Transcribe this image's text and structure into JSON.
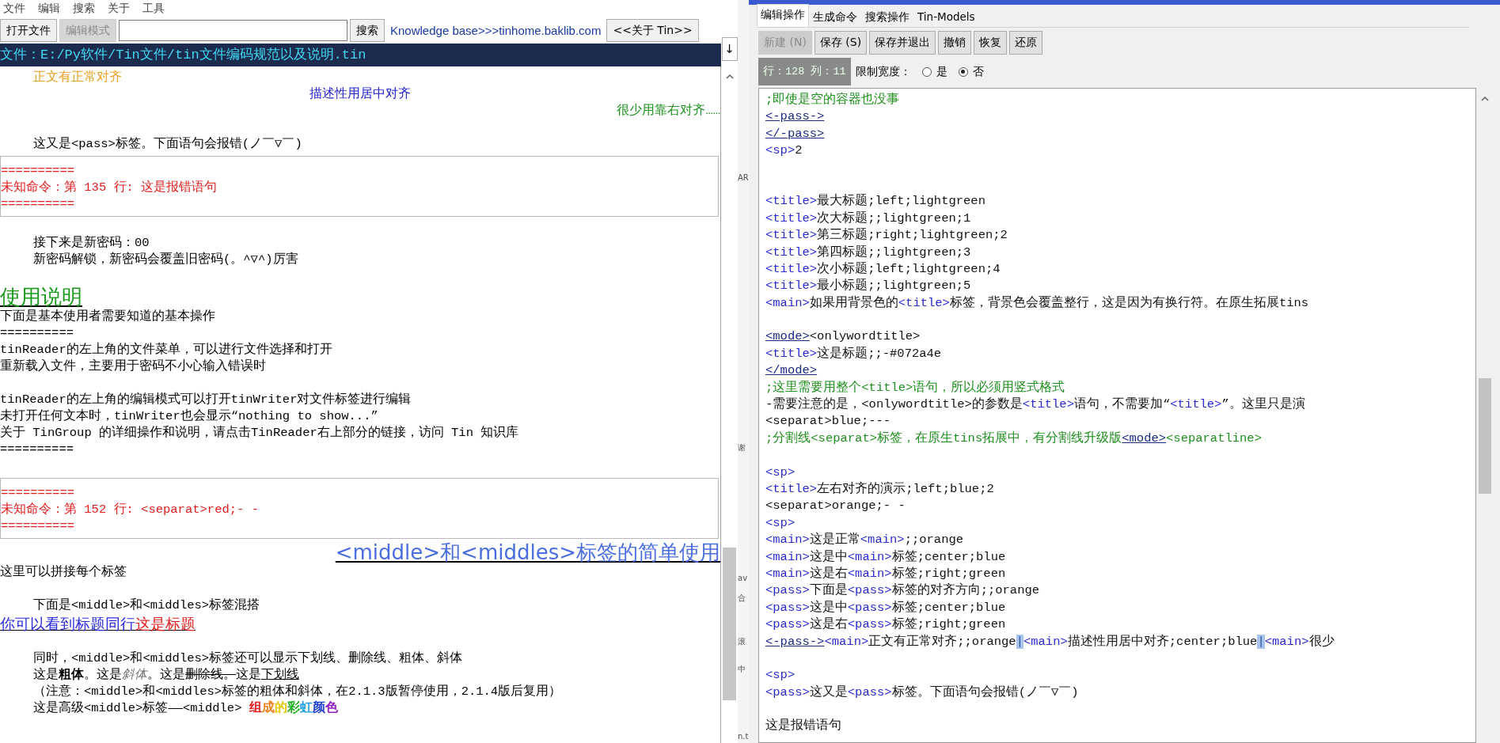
{
  "reader": {
    "menu": [
      "文件",
      "编辑",
      "搜索",
      "关于",
      "工具"
    ],
    "toolbar": {
      "open_button": {
        "label": "打开文件",
        "disabled": false
      },
      "edit_mode_button": {
        "label": "编辑模式",
        "disabled": true
      },
      "search_button": "搜索",
      "knowledge_link": "Knowledge base>>>tinhome.baklib.com",
      "about_button": "<<关于 Tin>>"
    },
    "scroll_down_button": "↓",
    "file_path": "文件：E:/Py软件/Tin文件/tin文件编码规范以及说明.tin",
    "lines": [
      {
        "kind": "indented",
        "segments": [
          {
            "text": "正文有正常对齐",
            "color": "#e8a020"
          }
        ]
      },
      {
        "kind": "center",
        "segments": [
          {
            "text": "描述性用居中对齐",
            "color": "#2020d0"
          }
        ]
      },
      {
        "kind": "right",
        "segments": [
          {
            "text": "很少用靠右对齐……",
            "color": "#209020"
          }
        ]
      },
      {
        "kind": "blank"
      },
      {
        "kind": "indented",
        "segments": [
          {
            "text": "这又是<pass>标签。下面语句会报错(ノ￣▽￣)"
          }
        ]
      },
      {
        "kind": "error_box",
        "lines": [
          "==========",
          "未知命令：第 135 行: 这是报错语句",
          "=========="
        ]
      },
      {
        "kind": "blank"
      },
      {
        "kind": "indented",
        "segments": [
          {
            "text": "接下来是新密码：00"
          }
        ]
      },
      {
        "kind": "indented",
        "segments": [
          {
            "text": "新密码解锁，新密码会覆盖旧密码(。^▽^)厉害"
          }
        ]
      },
      {
        "kind": "blank"
      },
      {
        "kind": "heading",
        "segments": [
          {
            "text": "使用说明",
            "color": "#1a9a1a"
          }
        ]
      },
      {
        "kind": "text",
        "segments": [
          {
            "text": "下面是基本使用者需要知道的基本操作"
          }
        ]
      },
      {
        "kind": "text",
        "segments": [
          {
            "text": "=========="
          }
        ]
      },
      {
        "kind": "text",
        "segments": [
          {
            "text": "tinReader的左上角的文件菜单，可以进行文件选择和打开"
          }
        ]
      },
      {
        "kind": "text",
        "segments": [
          {
            "text": "重新载入文件，主要用于密码不小心输入错误时"
          }
        ]
      },
      {
        "kind": "blank"
      },
      {
        "kind": "text",
        "segments": [
          {
            "text": "tinReader的左上角的编辑模式可以打开tinWriter对文件标签进行编辑"
          }
        ]
      },
      {
        "kind": "text",
        "segments": [
          {
            "text": "未打开任何文本时，tinWriter也会显示“nothing to show...”"
          }
        ]
      },
      {
        "kind": "text",
        "segments": [
          {
            "text": "关于 TinGroup 的详细操作和说明，请点击TinReader右上部分的链接，访问 Tin 知识库"
          }
        ]
      },
      {
        "kind": "text",
        "segments": [
          {
            "text": "=========="
          }
        ]
      },
      {
        "kind": "blank"
      },
      {
        "kind": "error_box",
        "lines": [
          "==========",
          "未知命令：第 152 行: <separat>red;- -",
          "=========="
        ]
      },
      {
        "kind": "heading_right",
        "segments": [
          {
            "text": "<middle>和<middles>标签的简单使用",
            "color": "#4a6ee0"
          }
        ]
      },
      {
        "kind": "text",
        "segments": [
          {
            "text": "这里可以拼接每个标签"
          }
        ]
      },
      {
        "kind": "blank"
      },
      {
        "kind": "indented",
        "segments": [
          {
            "text": "下面是<middle>和<middles>标签混搭"
          }
        ]
      },
      {
        "kind": "title",
        "segments": [
          {
            "text": "你可以看到标题同行",
            "color": "#2a2ae0"
          },
          {
            "text": "这是标题",
            "color": "#e02020"
          }
        ]
      },
      {
        "kind": "blank"
      },
      {
        "kind": "indented",
        "segments": [
          {
            "text": "同时，<middle>和<middles>标签还可以显示下划线、删除线、粗体、斜体"
          }
        ]
      },
      {
        "kind": "styles_demo",
        "segments": [
          {
            "text": "这是"
          },
          {
            "text": "粗体"
          },
          {
            "text": "。这是"
          },
          {
            "text": "斜体",
            "color": "#707070"
          },
          {
            "text": "。这是"
          },
          {
            "text": "删除线。"
          },
          {
            "text": "这是"
          },
          {
            "text": "下划线"
          }
        ]
      },
      {
        "kind": "indented",
        "segments": [
          {
            "text": "（注意：<middle>和<middles>标签的粗体和斜体，在2.1.3版暂停使用，2.1.4版后复用）"
          }
        ]
      },
      {
        "kind": "rainbow",
        "segments": [
          {
            "text": "这是高级<middle>标签——<middle> "
          },
          {
            "text": "组",
            "color": "#e02020"
          },
          {
            "text": "成",
            "color": "#f08020"
          },
          {
            "text": "的",
            "color": "#e8c800"
          },
          {
            "text": "彩",
            "color": "#20b020"
          },
          {
            "text": "虹",
            "color": "#20a0e0"
          },
          {
            "text": "颜",
            "color": "#2040d0"
          },
          {
            "text": "色",
            "color": "#9020c0"
          }
        ]
      }
    ]
  },
  "background_window": {
    "fragments": [
      "AR",
      "谢",
      "av",
      "合",
      "滚",
      "中",
      "n.t"
    ]
  },
  "writer": {
    "tabs": [
      {
        "label": "编辑操作",
        "selected": true
      },
      {
        "label": "生成命令",
        "selected": false
      },
      {
        "label": "搜索操作",
        "selected": false
      },
      {
        "label": "Tin-Models",
        "selected": false
      }
    ],
    "buttons": [
      {
        "label": "新建 (N)",
        "disabled": true
      },
      {
        "label": "保存 (S)",
        "disabled": false
      },
      {
        "label": "保存并退出",
        "disabled": false
      },
      {
        "label": "撤销",
        "disabled": false
      },
      {
        "label": "恢复",
        "disabled": false
      },
      {
        "label": "还原",
        "disabled": false
      }
    ],
    "cursor_position": "行：128 列：11",
    "width_limit": {
      "label": "限制宽度：",
      "options": [
        {
          "label": "是",
          "selected": false
        },
        {
          "label": "否",
          "selected": true
        }
      ]
    },
    "lines": [
      {
        "kind": "code",
        "segments": [
          {
            "kind": "comment",
            "text": ";即使是空的容器也没事"
          }
        ]
      },
      {
        "kind": "code",
        "segments": [
          {
            "kind": "link",
            "text": "<-pass->"
          }
        ]
      },
      {
        "kind": "code",
        "segments": [
          {
            "kind": "link",
            "text": "</-pass>"
          }
        ]
      },
      {
        "kind": "code",
        "segments": [
          {
            "kind": "tag",
            "text": "<sp>"
          },
          {
            "kind": "text",
            "text": "2"
          }
        ]
      },
      {
        "kind": "blank"
      },
      {
        "kind": "blank"
      },
      {
        "kind": "code",
        "segments": [
          {
            "kind": "tag",
            "text": "<title>"
          },
          {
            "kind": "text",
            "text": "最大标题;left;lightgreen"
          }
        ]
      },
      {
        "kind": "code",
        "segments": [
          {
            "kind": "tag",
            "text": "<title>"
          },
          {
            "kind": "text",
            "text": "次大标题;;lightgreen;1"
          }
        ]
      },
      {
        "kind": "code",
        "segments": [
          {
            "kind": "tag",
            "text": "<title>"
          },
          {
            "kind": "text",
            "text": "第三标题;right;lightgreen;2"
          }
        ]
      },
      {
        "kind": "code",
        "segments": [
          {
            "kind": "tag",
            "text": "<title>"
          },
          {
            "kind": "text",
            "text": "第四标题;;lightgreen;3"
          }
        ]
      },
      {
        "kind": "code",
        "segments": [
          {
            "kind": "tag",
            "text": "<title>"
          },
          {
            "kind": "text",
            "text": "次小标题;left;lightgreen;4"
          }
        ]
      },
      {
        "kind": "code",
        "segments": [
          {
            "kind": "tag",
            "text": "<title>"
          },
          {
            "kind": "text",
            "text": "最小标题;;lightgreen;5"
          }
        ]
      },
      {
        "kind": "code",
        "segments": [
          {
            "kind": "tag",
            "text": "<main>"
          },
          {
            "kind": "text",
            "text": "如果用背景色的"
          },
          {
            "kind": "tag",
            "text": "<title>"
          },
          {
            "kind": "text",
            "text": "标签，背景色会覆盖整行，这是因为有换行符。在原生拓展tins"
          }
        ]
      },
      {
        "kind": "blank"
      },
      {
        "kind": "code",
        "segments": [
          {
            "kind": "link",
            "text": "<mode>"
          },
          {
            "kind": "text",
            "text": "<onlywordtitle>"
          }
        ]
      },
      {
        "kind": "code",
        "segments": [
          {
            "kind": "tag",
            "text": "<title>"
          },
          {
            "kind": "text",
            "text": "这是标题;;-#072a4e"
          }
        ]
      },
      {
        "kind": "code",
        "segments": [
          {
            "kind": "link",
            "text": "</mode>"
          }
        ]
      },
      {
        "kind": "code",
        "segments": [
          {
            "kind": "comment",
            "text": ";这里需要用整个<title>语句，所以必须用竖式格式"
          }
        ]
      },
      {
        "kind": "code",
        "segments": [
          {
            "kind": "text",
            "text": "-需要注意的是，<onlywordtitle>的参数是"
          },
          {
            "kind": "tag",
            "text": "<title>"
          },
          {
            "kind": "text",
            "text": "语句，不需要加“"
          },
          {
            "kind": "tag",
            "text": "<title>"
          },
          {
            "kind": "text",
            "text": "”。这里只是演"
          }
        ]
      },
      {
        "kind": "code",
        "segments": [
          {
            "kind": "text",
            "text": "<separat>blue;---"
          }
        ]
      },
      {
        "kind": "code",
        "segments": [
          {
            "kind": "comment",
            "text": ";分割线<separat>标签，在原生tins拓展中，有分割线升级版"
          },
          {
            "kind": "link",
            "text": "<mode>"
          },
          {
            "kind": "comment",
            "text": "<separatline>"
          }
        ]
      },
      {
        "kind": "blank"
      },
      {
        "kind": "code",
        "segments": [
          {
            "kind": "tag",
            "text": "<sp>"
          }
        ]
      },
      {
        "kind": "code",
        "segments": [
          {
            "kind": "tag",
            "text": "<title>"
          },
          {
            "kind": "text",
            "text": "左右对齐的演示;left;blue;2"
          }
        ]
      },
      {
        "kind": "code",
        "segments": [
          {
            "kind": "text",
            "text": "<separat>orange;- -"
          }
        ]
      },
      {
        "kind": "code",
        "segments": [
          {
            "kind": "tag",
            "text": "<sp>"
          }
        ]
      },
      {
        "kind": "code",
        "segments": [
          {
            "kind": "tag",
            "text": "<main>"
          },
          {
            "kind": "text",
            "text": "这是正常"
          },
          {
            "kind": "tag",
            "text": "<main>"
          },
          {
            "kind": "text",
            "text": ";;orange"
          }
        ]
      },
      {
        "kind": "code",
        "segments": [
          {
            "kind": "tag",
            "text": "<main>"
          },
          {
            "kind": "text",
            "text": "这是中"
          },
          {
            "kind": "tag",
            "text": "<main>"
          },
          {
            "kind": "text",
            "text": "标签;center;blue"
          }
        ]
      },
      {
        "kind": "code",
        "segments": [
          {
            "kind": "tag",
            "text": "<main>"
          },
          {
            "kind": "text",
            "text": "这是右"
          },
          {
            "kind": "tag",
            "text": "<main>"
          },
          {
            "kind": "text",
            "text": "标签;right;green"
          }
        ]
      },
      {
        "kind": "code",
        "segments": [
          {
            "kind": "tag",
            "text": "<pass>"
          },
          {
            "kind": "text",
            "text": "下面是"
          },
          {
            "kind": "tag",
            "text": "<pass>"
          },
          {
            "kind": "text",
            "text": "标签的对齐方向;;orange"
          }
        ]
      },
      {
        "kind": "code",
        "segments": [
          {
            "kind": "tag",
            "text": "<pass>"
          },
          {
            "kind": "text",
            "text": "这是中"
          },
          {
            "kind": "tag",
            "text": "<pass>"
          },
          {
            "kind": "text",
            "text": "标签;center;blue"
          }
        ]
      },
      {
        "kind": "code",
        "segments": [
          {
            "kind": "tag",
            "text": "<pass>"
          },
          {
            "kind": "text",
            "text": "这是右"
          },
          {
            "kind": "tag",
            "text": "<pass>"
          },
          {
            "kind": "text",
            "text": "标签;right;green"
          }
        ]
      },
      {
        "kind": "code",
        "segments": [
          {
            "kind": "link",
            "text": "<-pass->"
          },
          {
            "kind": "tag",
            "text": "<main>"
          },
          {
            "kind": "text",
            "text": "正文有正常对齐;;orange"
          },
          {
            "kind": "marker",
            "text": "|"
          },
          {
            "kind": "tag",
            "text": "<main>"
          },
          {
            "kind": "text",
            "text": "描述性用居中对齐;center;blue"
          },
          {
            "kind": "marker",
            "text": "|"
          },
          {
            "kind": "tag",
            "text": "<main>"
          },
          {
            "kind": "text",
            "text": "很少"
          }
        ]
      },
      {
        "kind": "blank"
      },
      {
        "kind": "code",
        "segments": [
          {
            "kind": "tag",
            "text": "<sp>"
          }
        ]
      },
      {
        "kind": "code",
        "segments": [
          {
            "kind": "tag",
            "text": "<pass>"
          },
          {
            "kind": "text",
            "text": "这又是"
          },
          {
            "kind": "tag",
            "text": "<pass>"
          },
          {
            "kind": "text",
            "text": "标签。下面语句会报错(ノ￣▽￣)"
          }
        ]
      },
      {
        "kind": "blank"
      },
      {
        "kind": "code",
        "segments": [
          {
            "kind": "text",
            "text": "这是报错语句"
          }
        ]
      }
    ]
  }
}
